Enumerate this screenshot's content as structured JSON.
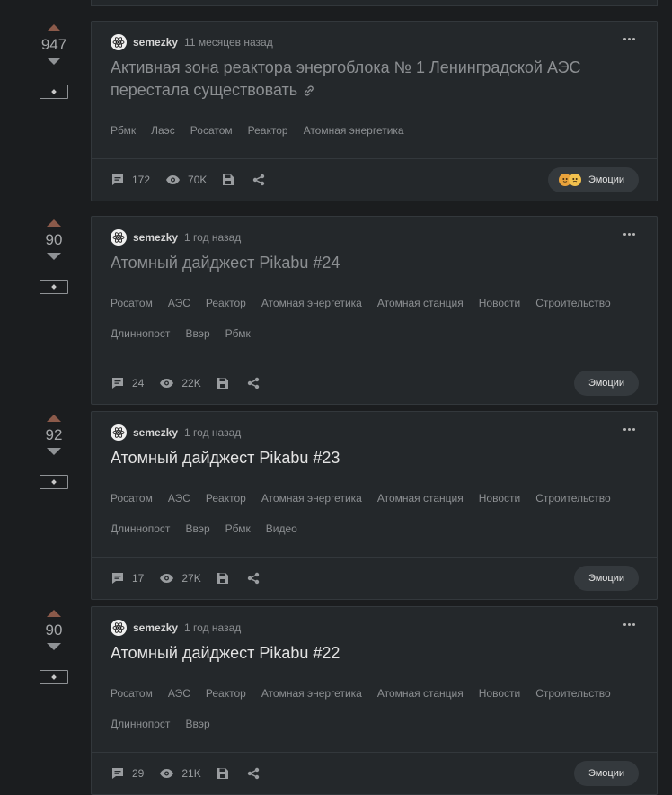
{
  "ui": {
    "emotions_label": "Эмоции"
  },
  "stories": [
    {
      "rating": "947",
      "author": "semezky",
      "time": "11 месяцев назад",
      "title": "Активная зона реактора энергоблока № 1 Ленинградской АЭС перестала существовать",
      "visited": true,
      "has_link_icon": true,
      "tags": [
        "Рбмк",
        "Лаэс",
        "Росатом",
        "Реактор",
        "Атомная энергетика"
      ],
      "comments": "172",
      "views": "70K",
      "has_emoji": true
    },
    {
      "rating": "90",
      "author": "semezky",
      "time": "1 год назад",
      "title": "Атомный дайджест Pikabu #24",
      "visited": true,
      "has_link_icon": false,
      "tags": [
        "Росатом",
        "АЭС",
        "Реактор",
        "Атомная энергетика",
        "Атомная станция",
        "Новости",
        "Строительство",
        "Длиннопост",
        "Ввэр",
        "Рбмк"
      ],
      "comments": "24",
      "views": "22K",
      "has_emoji": false
    },
    {
      "rating": "92",
      "author": "semezky",
      "time": "1 год назад",
      "title": "Атомный дайджест Pikabu #23",
      "visited": false,
      "has_link_icon": false,
      "tags": [
        "Росатом",
        "АЭС",
        "Реактор",
        "Атомная энергетика",
        "Атомная станция",
        "Новости",
        "Строительство",
        "Длиннопост",
        "Ввэр",
        "Рбмк",
        "Видео"
      ],
      "comments": "17",
      "views": "27K",
      "has_emoji": false
    },
    {
      "rating": "90",
      "author": "semezky",
      "time": "1 год назад",
      "title": "Атомный дайджест Pikabu #22",
      "visited": false,
      "has_link_icon": false,
      "tags": [
        "Росатом",
        "АЭС",
        "Реактор",
        "Атомная энергетика",
        "Атомная станция",
        "Новости",
        "Строительство",
        "Длиннопост",
        "Ввэр"
      ],
      "comments": "29",
      "views": "21K",
      "has_emoji": false
    }
  ],
  "colors": {
    "background": "#1b1d1f",
    "card": "#24282b",
    "upvote": "#8b5a4a",
    "visited_title": "#8c8f92",
    "fresh_title": "#e3e3e3"
  }
}
